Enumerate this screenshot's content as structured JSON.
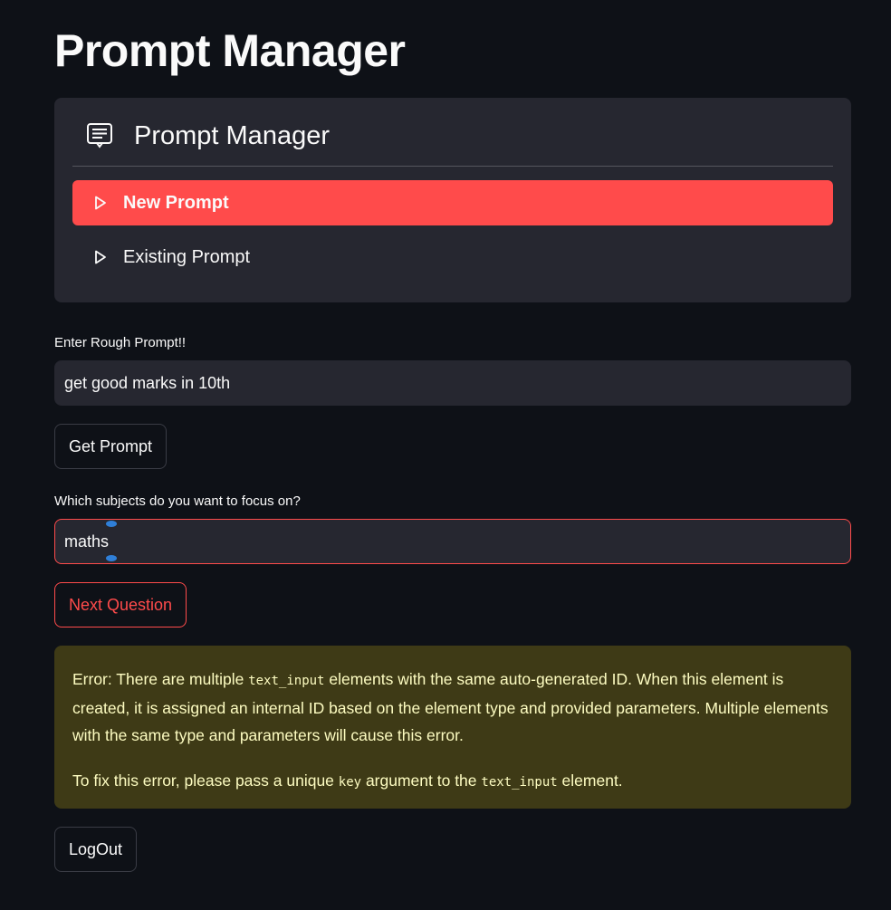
{
  "page": {
    "title": "Prompt Manager"
  },
  "menu": {
    "title": "Prompt Manager",
    "items": [
      {
        "label": "New Prompt",
        "active": true
      },
      {
        "label": "Existing Prompt",
        "active": false
      }
    ],
    "accent_color": "#ff4b4b"
  },
  "rough_prompt": {
    "label": "Enter Rough Prompt!!",
    "value": "get good marks in 10th"
  },
  "get_prompt_button": {
    "label": "Get Prompt"
  },
  "subjects": {
    "label": "Which subjects do you want to focus on?",
    "value": "maths"
  },
  "next_question_button": {
    "label": "Next Question"
  },
  "error": {
    "p1_part1": "Error: There are multiple ",
    "p1_code": "text_input",
    "p1_part2": " elements with the same auto-generated ID. When this element is created, it is assigned an internal ID based on the element type and provided parameters. Multiple elements with the same type and parameters will cause this error.",
    "p2_part1": "To fix this error, please pass a unique ",
    "p2_code1": "key",
    "p2_part2": " argument to the ",
    "p2_code2": "text_input",
    "p2_part3": " element."
  },
  "logout_button": {
    "label": "LogOut"
  },
  "icons": {
    "menu_icon": "card-text-icon",
    "item_icon": "caret-right-icon"
  }
}
